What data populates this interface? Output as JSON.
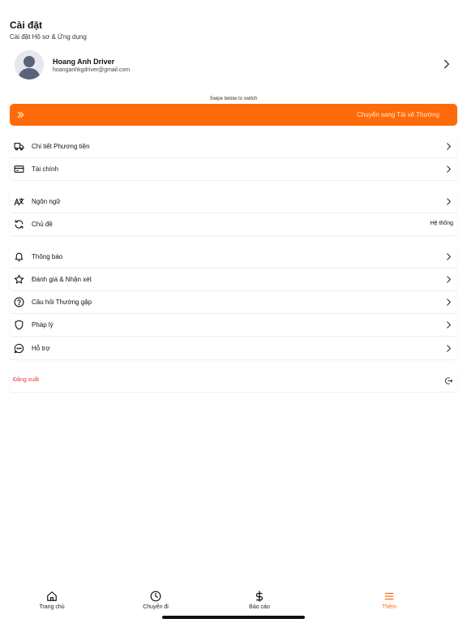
{
  "header": {
    "title": "Cài đặt",
    "subtitle": "Cài đặt Hồ sơ & Ứng dụng"
  },
  "profile": {
    "name": "Hoang Anh Driver",
    "email": "hoanganhkgdriver@gmail.com",
    "avatar_icon": "user-avatar-icon"
  },
  "switch": {
    "hint": "Swipe below to switch",
    "label": "Chuyển sang Tài xế Thường",
    "color": "#ff6a0a"
  },
  "sections": {
    "vehicle": {
      "label": "Chi tiết Phương tiện",
      "icon": "truck-icon"
    },
    "finance": {
      "label": "Tài chính",
      "icon": "credit-card-icon"
    },
    "language": {
      "label": "Ngôn ngữ",
      "icon": "translate-icon"
    },
    "theme": {
      "label": "Chủ đề",
      "value": "Hệ thống",
      "icon": "refresh-icon"
    },
    "notifications": {
      "label": "Thông báo",
      "icon": "bell-icon"
    },
    "reviews": {
      "label": "Đánh giá & Nhận xét",
      "icon": "star-icon"
    },
    "faq": {
      "label": "Câu hỏi Thường gặp",
      "icon": "help-circle-icon"
    },
    "legal": {
      "label": "Pháp lý",
      "icon": "shield-icon"
    },
    "support": {
      "label": "Hỗ trợ",
      "icon": "chat-icon"
    }
  },
  "logout": {
    "label": "Đăng xuất",
    "color": "#e53935",
    "icon": "logout-icon"
  },
  "nav": {
    "home": "Trang chủ",
    "trips": "Chuyến đi",
    "reports": "Báo cáo",
    "more": "Thêm",
    "active_color": "#ff6a0a"
  }
}
